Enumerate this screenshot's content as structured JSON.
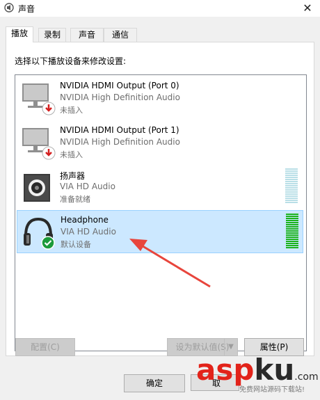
{
  "window": {
    "title": "声音"
  },
  "tabs": [
    {
      "label": "播放"
    },
    {
      "label": "录制"
    },
    {
      "label": "声音"
    },
    {
      "label": "通信"
    }
  ],
  "instruction": "选择以下播放设备来修改设置:",
  "devices": [
    {
      "name": "NVIDIA HDMI Output (Port 0)",
      "description": "NVIDIA High Definition Audio",
      "status": "未插入",
      "icon": "monitor-icon",
      "badge": "unplugged-badge-icon"
    },
    {
      "name": "NVIDIA HDMI Output (Port 1)",
      "description": "NVIDIA High Definition Audio",
      "status": "未插入",
      "icon": "monitor-icon",
      "badge": "unplugged-badge-icon"
    },
    {
      "name": "扬声器",
      "description": "VIA HD Audio",
      "status": "准备就绪",
      "icon": "speaker-icon",
      "meter_level": 0
    },
    {
      "name": "Headphone",
      "description": "VIA HD Audio",
      "status": "默认设备",
      "icon": "headphone-icon",
      "badge": "default-check-icon",
      "meter_level": 1.0,
      "selected": true
    }
  ],
  "buttons": {
    "configure": "配置(C)",
    "set_default": "设为默认值(S)",
    "properties": "属性(P)",
    "ok": "确定",
    "cancel": "取"
  },
  "watermark": {
    "brand": "aspku",
    "brand_accent": "ku",
    "suffix": ".com",
    "tagline": "免费网站源码下载站!"
  },
  "colors": {
    "selection_bg": "#cce8ff",
    "meter_active": "#1bb31b",
    "meter_idle": "#b9dfe7",
    "arrow": "#e8453c",
    "brand_red": "#e2231a"
  }
}
